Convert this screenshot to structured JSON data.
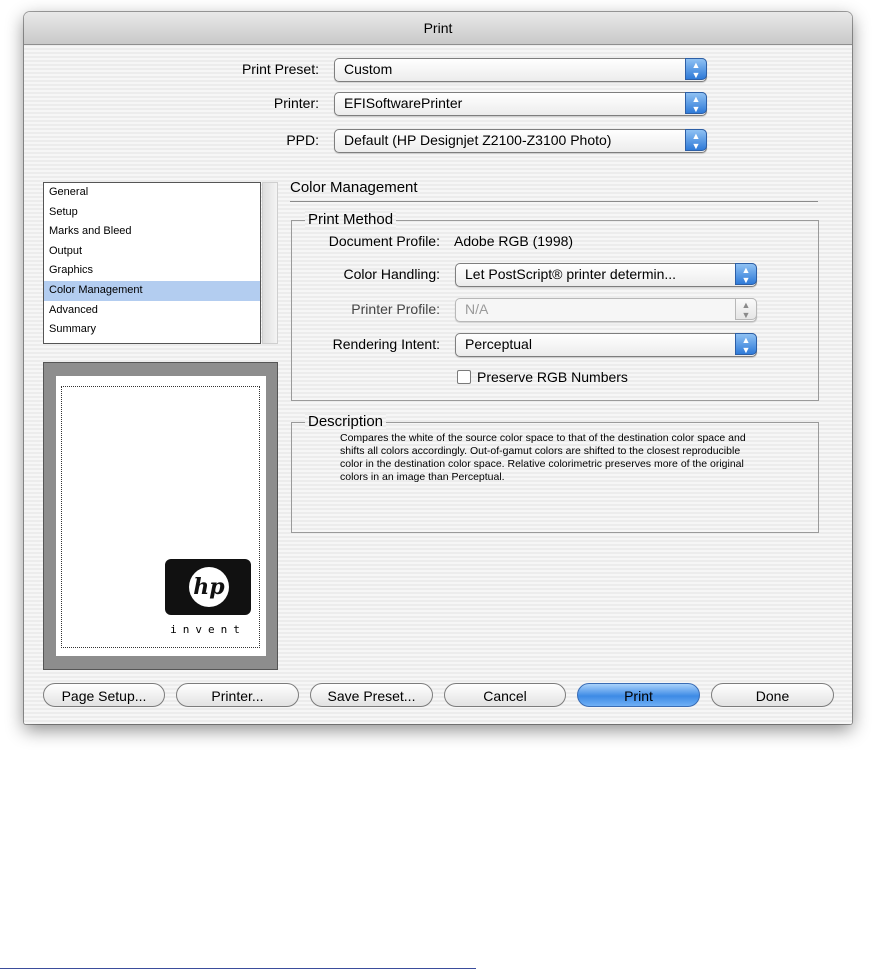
{
  "window": {
    "title": "Print"
  },
  "presets": {
    "print_preset_label": "Print Preset:",
    "print_preset_value": "Custom",
    "printer_label": "Printer:",
    "printer_value": "EFISoftwarePrinter",
    "ppd_label": "PPD:",
    "ppd_value": "Default (HP Designjet Z2100-Z3100 Photo)"
  },
  "sidebar": {
    "items": [
      "General",
      "Setup",
      "Marks and Bleed",
      "Output",
      "Graphics",
      "Color Management",
      "Advanced",
      "Summary"
    ],
    "selected": "Color Management"
  },
  "preview": {
    "logo_text": "hp",
    "logo_tagline": "invent"
  },
  "panel": {
    "title": "Color Management",
    "print_method": {
      "title": "Print Method",
      "document_profile_label": "Document Profile:",
      "document_profile_value": "Adobe RGB (1998)",
      "color_handling_label": "Color Handling:",
      "color_handling_value": "Let PostScript® printer determin...",
      "printer_profile_label": "Printer Profile:",
      "printer_profile_value": "N/A",
      "rendering_intent_label": "Rendering Intent:",
      "rendering_intent_value": "Perceptual",
      "preserve_rgb_label": "Preserve RGB Numbers",
      "preserve_rgb_checked": false
    },
    "description": {
      "title": "Description",
      "text": "Compares the white of the source color space to that of the destination color space and shifts all colors accordingly. Out-of-gamut colors are shifted to the closest reproducible color in the destination color space. Relative colorimetric preserves more of the original colors in an image than Perceptual."
    }
  },
  "buttons": {
    "page_setup": "Page Setup...",
    "printer": "Printer...",
    "save_preset": "Save Preset...",
    "cancel": "Cancel",
    "print": "Print",
    "done": "Done"
  },
  "icons": {
    "popup_arrows": "up-down-arrows-icon"
  },
  "colors": {
    "accent": "#3d8ae5",
    "selection": "#b3cdf0"
  }
}
